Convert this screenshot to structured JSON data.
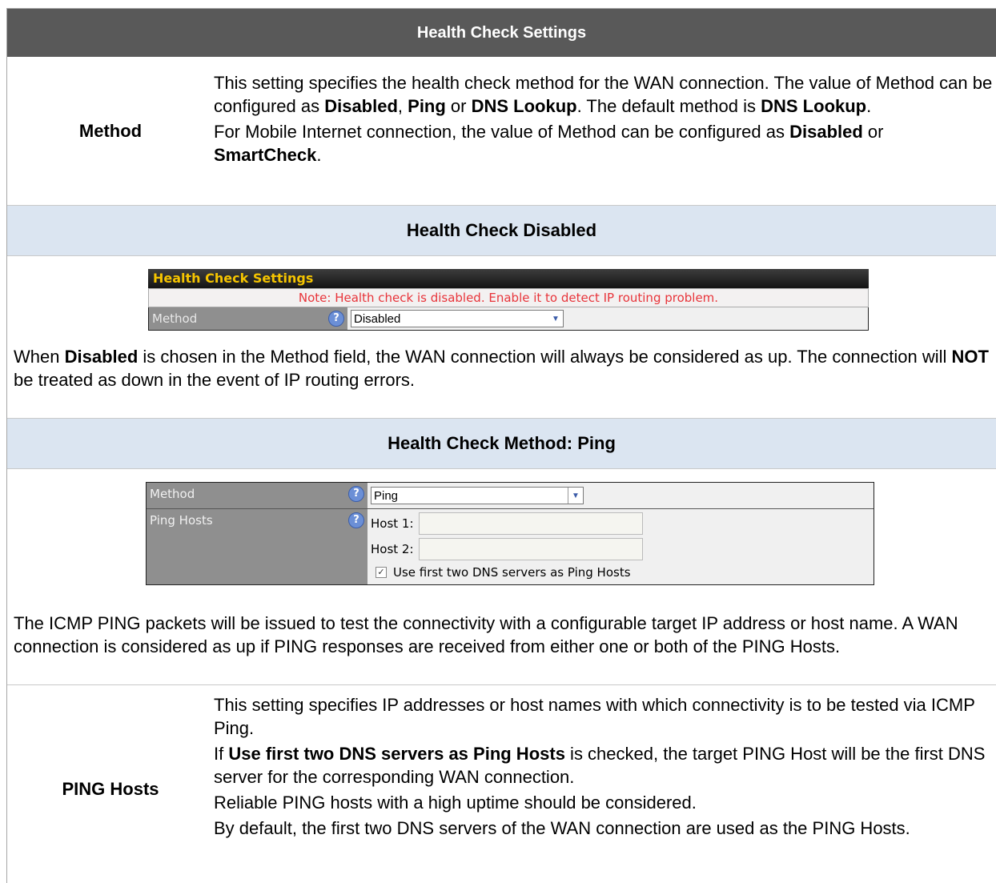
{
  "header": {
    "title": "Health Check Settings"
  },
  "method_row": {
    "label": "Method",
    "d1a": "This setting specifies the health check method for the WAN connection. The value of Method can be configured as ",
    "d1b": "Disabled",
    "d1c": ", ",
    "d1d": "Ping",
    "d1e": " or ",
    "d1f": "DNS Lookup",
    "d1g": ". The default method is ",
    "d1h": "DNS Lookup",
    "d1i": ".",
    "d2a": "For Mobile Internet connection, the value of Method can be configured as ",
    "d2b": "Disabled",
    "d2c": " or ",
    "d2d": "SmartCheck",
    "d2e": "."
  },
  "disabled_section": {
    "title": "Health Check Disabled",
    "shot": {
      "bar_title": "Health Check Settings",
      "note": "Note: Health check is disabled. Enable it to detect IP routing problem.",
      "method_label": "Method",
      "method_value": "Disabled"
    },
    "p1a": "When ",
    "p1b": "Disabled",
    "p1c": " is chosen in the Method field, the WAN connection will always be considered as up. The connection will ",
    "p1d": "NOT",
    "p1e": " be treated as down in the event of IP routing errors."
  },
  "ping_section": {
    "title": "Health Check Method: Ping",
    "shot": {
      "method_label": "Method",
      "method_value": "Ping",
      "hosts_label": "Ping Hosts",
      "host1_label": "Host 1:",
      "host2_label": "Host 2:",
      "checkbox_label": "Use first two DNS servers as Ping Hosts",
      "checkbox_checked": true
    },
    "para": "The ICMP PING packets will be issued to test the connectivity with a configurable target IP address or host name.  A WAN connection is considered as up if PING responses are received from either one or both of the PING Hosts."
  },
  "ping_hosts_row": {
    "label": "PING Hosts",
    "d1": "This setting specifies IP addresses or host names with which connectivity is to be tested via ICMP Ping.",
    "d2a": "If ",
    "d2b": "Use first two DNS servers as Ping Hosts",
    "d2c": " is checked, the target PING Host will be the first DNS server for the corresponding WAN connection.",
    "d3": "Reliable PING hosts with a high uptime should be considered.",
    "d4": "By default, the first two DNS servers of the WAN connection are used as the PING Hosts."
  }
}
